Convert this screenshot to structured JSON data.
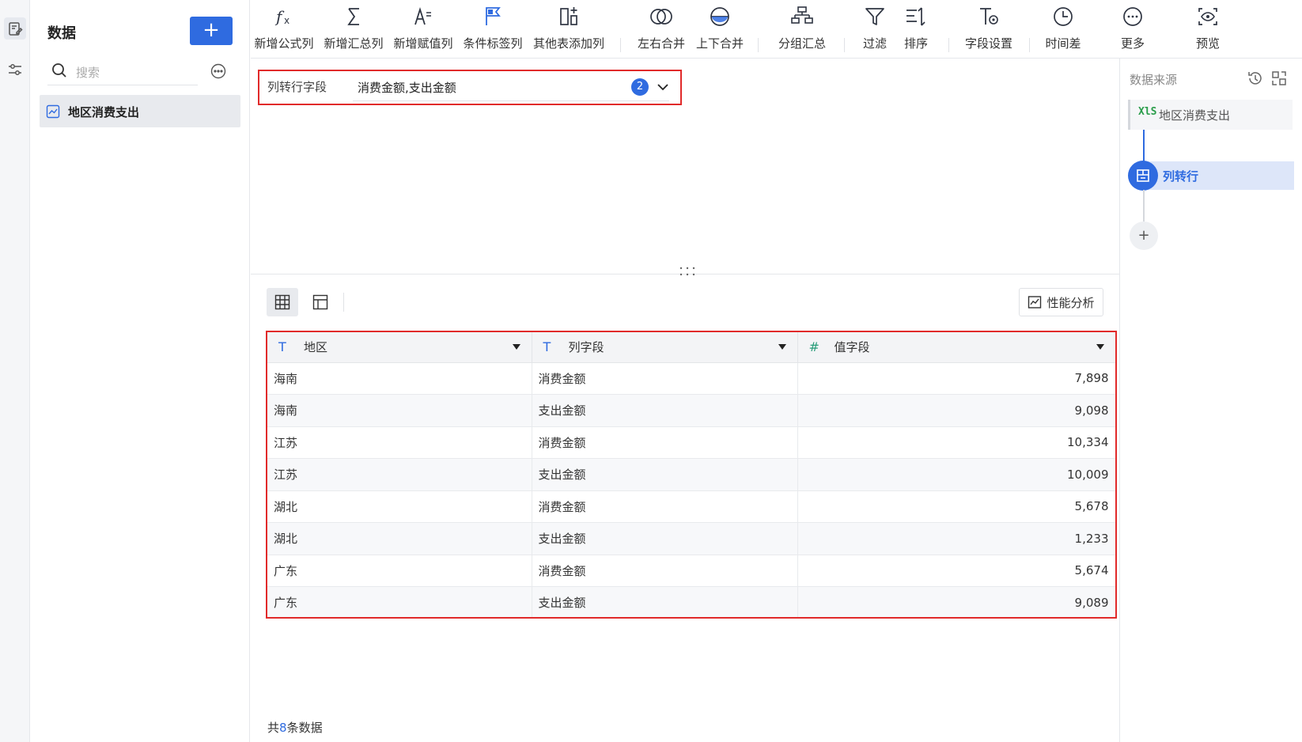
{
  "sidebar": {
    "title": "数据",
    "add_label": "+",
    "search_placeholder": "搜索",
    "items": [
      {
        "label": "地区消费支出"
      }
    ]
  },
  "toolbar": {
    "items": [
      {
        "label": "新增公式列",
        "icon": "fx-icon"
      },
      {
        "label": "新增汇总列",
        "icon": "sigma-icon"
      },
      {
        "label": "新增赋值列",
        "icon": "assign-icon"
      },
      {
        "label": "条件标签列",
        "icon": "flag-icon"
      },
      {
        "label": "其他表添加列",
        "icon": "add-column-icon"
      },
      {
        "label": "左右合并",
        "icon": "join-icon"
      },
      {
        "label": "上下合并",
        "icon": "union-icon"
      },
      {
        "label": "分组汇总",
        "icon": "group-icon"
      },
      {
        "label": "过滤",
        "icon": "filter-icon"
      },
      {
        "label": "排序",
        "icon": "sort-icon"
      },
      {
        "label": "字段设置",
        "icon": "field-settings-icon"
      },
      {
        "label": "时间差",
        "icon": "clock-icon"
      },
      {
        "label": "更多",
        "icon": "more-icon"
      },
      {
        "label": "预览",
        "icon": "preview-icon"
      }
    ]
  },
  "config": {
    "label": "列转行字段",
    "value": "消费金额,支出金额",
    "count": "2"
  },
  "view": {
    "perf_label": "性能分析"
  },
  "table": {
    "columns": [
      {
        "label": "地区",
        "type_icon": "T",
        "type": "text"
      },
      {
        "label": "列字段",
        "type_icon": "T",
        "type": "text"
      },
      {
        "label": "值字段",
        "type_icon": "#",
        "type": "number"
      }
    ],
    "rows": [
      [
        "海南",
        "消费金额",
        "7,898"
      ],
      [
        "海南",
        "支出金额",
        "9,098"
      ],
      [
        "江苏",
        "消费金额",
        "10,334"
      ],
      [
        "江苏",
        "支出金额",
        "10,009"
      ],
      [
        "湖北",
        "消费金额",
        "5,678"
      ],
      [
        "湖北",
        "支出金额",
        "1,233"
      ],
      [
        "广东",
        "消费金额",
        "5,674"
      ],
      [
        "广东",
        "支出金额",
        "9,089"
      ]
    ]
  },
  "footer": {
    "prefix": "共",
    "count": "8",
    "suffix": "条数据"
  },
  "pipeline": {
    "title": "数据来源",
    "source_icon_text": "XlS",
    "source_label": "地区消费支出",
    "step_label": "列转行",
    "add_label": "+"
  },
  "colors": {
    "accent": "#2f6be0",
    "highlight_border": "#e12a2a",
    "number_type": "#2a9d7a"
  }
}
